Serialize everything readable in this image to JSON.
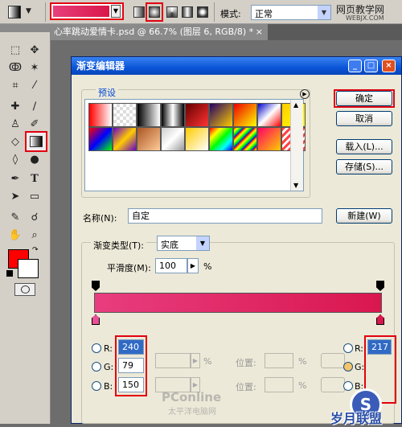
{
  "options_bar": {
    "mode_label": "模式:",
    "mode_value": "正常",
    "watermark": "网页教学网",
    "watermark_sub": "WEBJX.COM",
    "gradient_preview": [
      "#e73f7c",
      "#d9174a"
    ]
  },
  "document_tab": {
    "title": "心率跳动爱情卡.psd @ 66.7% (图层 6, RGB/8) *"
  },
  "toolbox": {
    "foreground_color": "#ff0000",
    "background_color": "#ffffff"
  },
  "dialog": {
    "title": "渐变编辑器",
    "presets_label": "预设",
    "buttons": {
      "ok": "确定",
      "cancel": "取消",
      "load": "载入(L)...",
      "save": "存储(S)...",
      "new": "新建(W)"
    },
    "name_label": "名称(N):",
    "name_value": "自定",
    "gradient_type_label": "渐变类型(T):",
    "gradient_type_value": "实底",
    "smoothness_label": "平滑度(M):",
    "smoothness_value": "100",
    "smoothness_unit": "%",
    "gradient_bar": {
      "start": "#e83d7f",
      "end": "#d9174f"
    },
    "left_color": {
      "r_label": "R:",
      "r": "240",
      "g_label": "G:",
      "g": "79",
      "b_label": "B:",
      "b": "150"
    },
    "right_color": {
      "r_label": "R:",
      "r": "217",
      "g_label": "G:",
      "b_label": "B:"
    },
    "stop_row": {
      "percent": "%",
      "location_label": "位置:",
      "location_percent": "%"
    },
    "watermark_center": "PConline",
    "watermark_center_sub": "太平洋电脑网",
    "watermark_corner": "岁月联盟"
  }
}
